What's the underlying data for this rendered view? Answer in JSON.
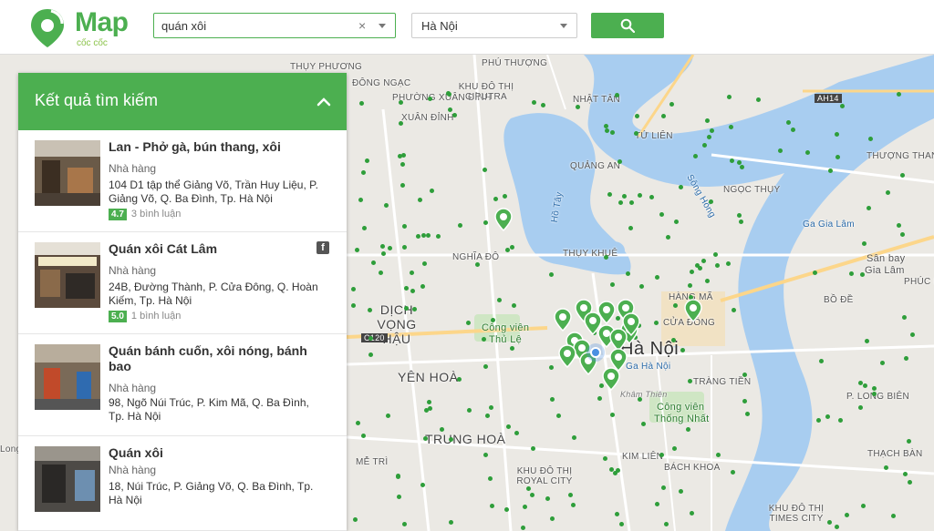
{
  "header": {
    "logo_text": "Map",
    "logo_sub": "cốc cốc",
    "search_value": "quán xôi",
    "clear_glyph": "×",
    "city_value": "Hà Nội",
    "icons": {
      "logo": "map-pin-logo-icon",
      "clear": "close-icon",
      "caret": "chevron-down-icon",
      "search": "search-icon"
    }
  },
  "colors": {
    "brand": "#4caf50",
    "pin": "#4caf50",
    "dot": "#2e9e3a"
  },
  "panel": {
    "title": "Kết quả tìm kiếm",
    "results": [
      {
        "title": "Lan - Phở gà, bún thang, xôi",
        "category": "Nhà hàng",
        "address": "104 D1 tập thể Giảng Võ, Trần Huy Liệu, P. Giảng Võ, Q. Ba Đình, Tp. Hà Nội",
        "rating": "4.7",
        "reviews": "3 bình luận"
      },
      {
        "title": "Quán xôi Cát Lâm",
        "category": "Nhà hàng",
        "address": "24B, Đường Thành, P. Cửa Đông, Q. Hoàn Kiếm, Tp. Hà Nội",
        "rating": "5.0",
        "reviews": "1 bình luận",
        "fb": "f"
      },
      {
        "title": "Quán bánh cuốn, xôi nóng, bánh bao",
        "category": "Nhà hàng",
        "address": "98, Ngõ Núi Trúc, P. Kim Mã, Q. Ba Đình, Tp. Hà Nội"
      },
      {
        "title": "Quán xôi",
        "category": "Nhà hàng",
        "address": "18, Núi Trúc, P. Giảng Võ, Q. Ba Đình, Tp. Hà Nội"
      }
    ]
  },
  "map": {
    "labels": {
      "phu_thuong": "PHÚ THƯỢNG",
      "thuy_phuong": "THỤY PHƯƠNG",
      "dong_ngac": "ĐÔNG NGẠC",
      "xuan_dinh": "PHƯỜNG XUÂN ĐỈNH",
      "xuan_dinh2": "XUÂN ĐỈNH",
      "ciputra": "KHU ĐÔ THỊ CIPUTRA",
      "nhat_tan": "NHẬT TÂN",
      "tu_lien": "TỨ LIÊN",
      "quang_an": "QUẢNG AN",
      "ngoc_thuy": "NGỌC THỤY",
      "thuong_thanh": "THƯỢNG THANH",
      "thuy_khue": "THỤY KHUÊ",
      "nghia_do": "NGHĨA ĐÔ",
      "dich_vong_hau": "DỊCH VỌNG HẬU",
      "yen_hoa": "YÊN HOÀ",
      "trung_hoa": "TRUNG HOÀ",
      "ha_noi": "Hà Nội",
      "hang_ma": "HÀNG MÃ",
      "cua_dong": "CỬA ĐÔNG",
      "trang_tien": "TRÀNG TIỀN",
      "bo_de": "BỒ ĐỀ",
      "phuc_loi": "PHÚC LỢI",
      "p_long_bien": "P. LONG BIÊN",
      "thach_ban": "THẠCH BÀN",
      "san_bay": "Sân bay",
      "gia_lam": "Gia Lâm",
      "ga_gia_lam": "Ga Gia Lâm",
      "cv_thu_le": "Công viên",
      "cv_thu_le2": "Thủ Lệ",
      "cv_thong_nhat": "Công viên",
      "cv_thong_nhat2": "Thống Nhất",
      "ho_tay": "Hồ Tây",
      "song_hong": "Sông Hồng",
      "ah14": "AH14",
      "c120": "C120",
      "bach_khoa": "BÁCH KHOA",
      "royal_city": "KHU ĐÔ THỊ ROYAL CITY",
      "times_city": "KHU ĐÔ THỊ TIMES CITY",
      "me_tri": "MỄ TRÌ",
      "long": "Long",
      "kim_lien": "KIM LIÊN",
      "ga_ha_noi": "Ga Hà Nội",
      "khai_thien": "Khâm Thiên"
    }
  }
}
